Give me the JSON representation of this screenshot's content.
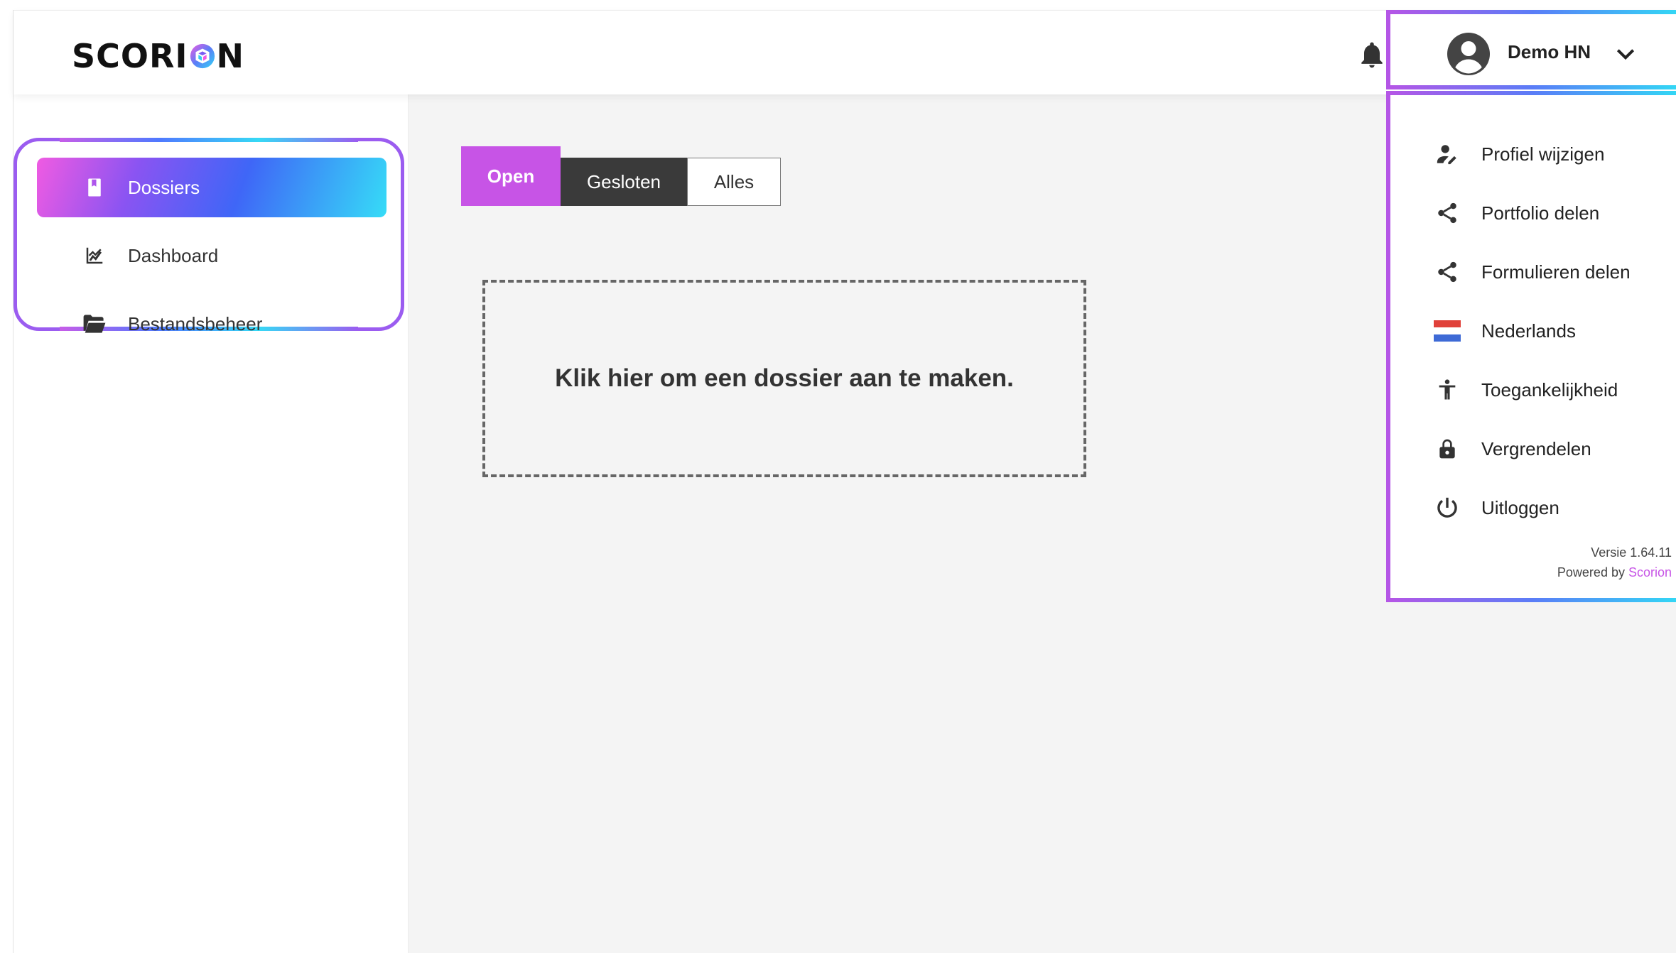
{
  "app": {
    "logo_text_left": "SCORI",
    "logo_text_right": "N"
  },
  "header": {
    "notifications_icon": "bell-icon",
    "user_name": "Demo HN"
  },
  "sidebar": {
    "items": [
      {
        "label": "Dossiers",
        "icon": "book-icon",
        "active": true
      },
      {
        "label": "Dashboard",
        "icon": "chart-line-icon",
        "active": false
      },
      {
        "label": "Bestandsbeheer",
        "icon": "folder-open-icon",
        "active": false
      }
    ]
  },
  "main": {
    "tabs": [
      {
        "label": "Open",
        "active": true
      },
      {
        "label": "Gesloten",
        "active": false
      },
      {
        "label": "Alles",
        "active": false
      }
    ],
    "empty_prompt": "Klik hier om een dossier aan te maken."
  },
  "user_menu": {
    "items": [
      {
        "label": "Profiel wijzigen",
        "icon": "user-edit-icon"
      },
      {
        "label": "Portfolio delen",
        "icon": "share-icon"
      },
      {
        "label": "Formulieren delen",
        "icon": "share-icon"
      },
      {
        "label": "Nederlands",
        "icon": "dutch-flag-icon"
      },
      {
        "label": "Toegankelijkheid",
        "icon": "accessibility-icon"
      },
      {
        "label": "Vergrendelen",
        "icon": "lock-icon"
      },
      {
        "label": "Uitloggen",
        "icon": "power-icon"
      }
    ],
    "version": "Versie 1.64.11",
    "powered_by_prefix": "Powered by ",
    "powered_by_brand": "Scorion"
  },
  "colors": {
    "accent": "#c754e6",
    "frame": "#9b5cf0",
    "dark_tab": "#3a3a3a"
  }
}
